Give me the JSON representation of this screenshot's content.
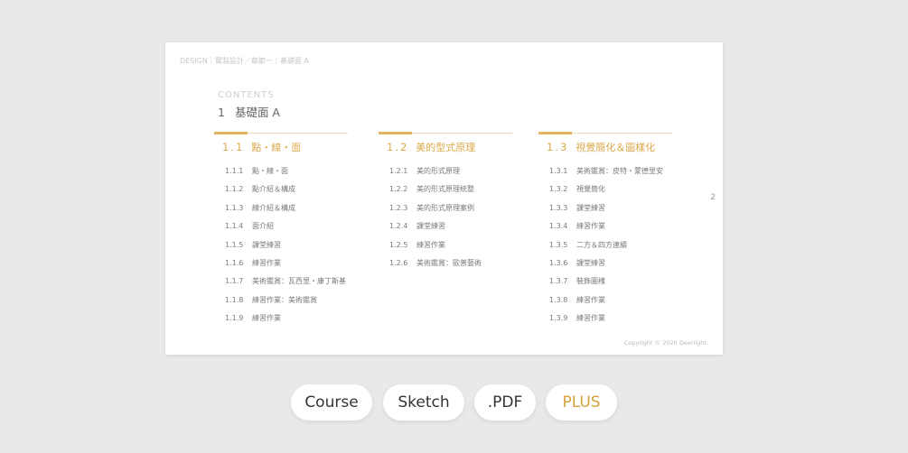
{
  "page": {
    "breadcrumb": "DESIGN｜實製設計／章節一｜基礎面 A",
    "contents_label": "CONTENTS",
    "chapter_number": "1",
    "chapter_title": "基礎面 A",
    "page_number": "2",
    "copyright": "Copyright © 2020 Deerlight."
  },
  "sections": [
    {
      "number": "1.1",
      "title": "點・線・面",
      "items": [
        {
          "num": "1.1.1",
          "title": "點・線・面"
        },
        {
          "num": "1.1.2",
          "title": "點介紹＆構成"
        },
        {
          "num": "1.1.3",
          "title": "線介紹＆構成"
        },
        {
          "num": "1.1.4",
          "title": "面介紹"
        },
        {
          "num": "1.1.5",
          "title": "課堂練習"
        },
        {
          "num": "1.1.6",
          "title": "練習作業"
        },
        {
          "num": "1.1.7",
          "title": "美術鑑賞：瓦西里・康丁斯基"
        },
        {
          "num": "1.1.8",
          "title": "練習作業：美術鑑賞"
        },
        {
          "num": "1.1.9",
          "title": "練習作業"
        }
      ]
    },
    {
      "number": "1.2",
      "title": "美的型式原理",
      "items": [
        {
          "num": "1.2.1",
          "title": "美的形式原理"
        },
        {
          "num": "1.2.2",
          "title": "美的形式原理統整"
        },
        {
          "num": "1.2.3",
          "title": "美的形式原理案例"
        },
        {
          "num": "1.2.4",
          "title": "課堂練習"
        },
        {
          "num": "1.2.5",
          "title": "練習作業"
        },
        {
          "num": "1.2.6",
          "title": "美術鑑賞：歐普藝術"
        }
      ]
    },
    {
      "number": "1.3",
      "title": "視覺簡化＆圖樣化",
      "items": [
        {
          "num": "1.3.1",
          "title": "美術鑑賞：皮特・蒙德里安"
        },
        {
          "num": "1.3.2",
          "title": "視覺簡化"
        },
        {
          "num": "1.3.3",
          "title": "課堂練習"
        },
        {
          "num": "1.3.4",
          "title": "練習作業"
        },
        {
          "num": "1.3.5",
          "title": "二方＆四方連續"
        },
        {
          "num": "1.3.6",
          "title": "課堂練習"
        },
        {
          "num": "1.3.7",
          "title": "裝飾圖樣"
        },
        {
          "num": "1.3.8",
          "title": "練習作業"
        },
        {
          "num": "1.3.9",
          "title": "練習作業"
        }
      ]
    }
  ],
  "buttons": {
    "course": "Course",
    "sketch": "Sketch",
    "pdf": ".PDF",
    "plus": "PLUS"
  },
  "colors": {
    "background": "#e9e9e9",
    "accent": "#dba94a",
    "accent_bar": "#e3b45c",
    "plus_text": "#d6a13c"
  }
}
